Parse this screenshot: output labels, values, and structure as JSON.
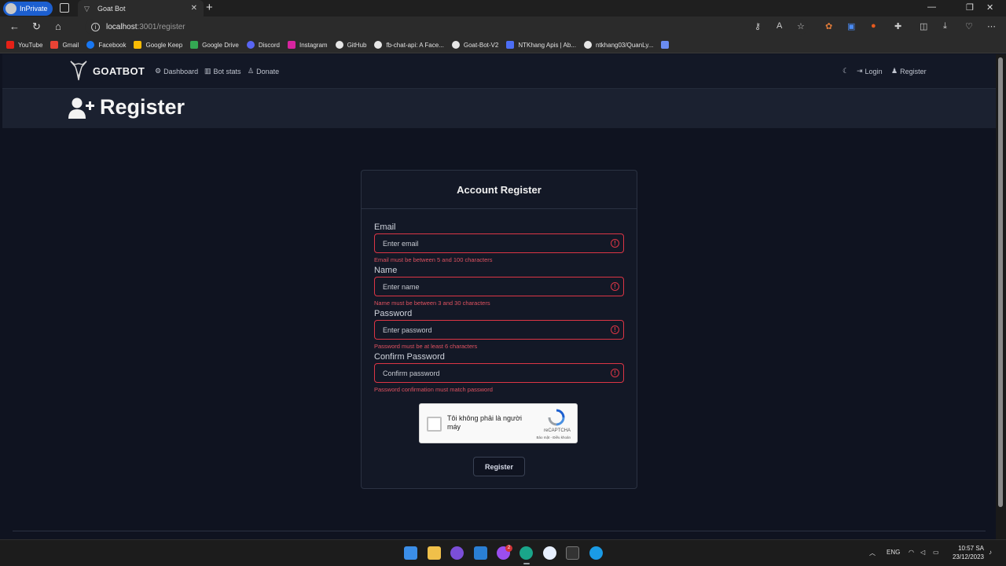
{
  "browser": {
    "inprivate_label": "InPrivate",
    "tab_title": "Goat Bot",
    "url_host": "localhost",
    "url_path": ":3001/register"
  },
  "bookmarks": [
    {
      "label": "YouTube",
      "color": "#e62117"
    },
    {
      "label": "Gmail",
      "color": "#ea4335"
    },
    {
      "label": "Facebook",
      "color": "#1877f2"
    },
    {
      "label": "Google Keep",
      "color": "#fbbc04"
    },
    {
      "label": "Google Drive",
      "color": "#34a853"
    },
    {
      "label": "Discord",
      "color": "#5865f2"
    },
    {
      "label": "Instagram",
      "color": "#d6249f"
    },
    {
      "label": "GitHub",
      "color": "#e6e6e6"
    },
    {
      "label": "fb-chat-api: A Face...",
      "color": "#e6e6e6"
    },
    {
      "label": "Goat-Bot-V2",
      "color": "#e6e6e6"
    },
    {
      "label": "NTKhang Apis | Ab...",
      "color": "#4c6ef5"
    },
    {
      "label": "ntkhang03/QuanLy...",
      "color": "#e6e6e6"
    }
  ],
  "navbar": {
    "brand": "GOATBOT",
    "links": [
      "Dashboard",
      "Bot stats",
      "Donate"
    ],
    "login": "Login",
    "register": "Register"
  },
  "header": {
    "title": "Register"
  },
  "form": {
    "title": "Account Register",
    "fields": [
      {
        "label": "Email",
        "placeholder": "Enter email",
        "error": "Email must be between 5 and 100 characters"
      },
      {
        "label": "Name",
        "placeholder": "Enter name",
        "error": "Name must be between 3 and 30 characters"
      },
      {
        "label": "Password",
        "placeholder": "Enter password",
        "error": "Password must be at least 6 characters"
      },
      {
        "label": "Confirm Password",
        "placeholder": "Confirm password",
        "error": "Password confirmation must match password"
      }
    ],
    "captcha_text": "Tôi không phải là người máy",
    "captcha_brand": "reCAPTCHA",
    "captcha_terms": "Bảo mật - Điều khoản",
    "submit": "Register"
  },
  "taskbar": {
    "lang": "ENG",
    "time": "10:57 SA",
    "date": "23/12/2023",
    "messenger_badge": "2"
  },
  "colors": {
    "error": "#dc3545",
    "accent": "#1c5fd0"
  }
}
